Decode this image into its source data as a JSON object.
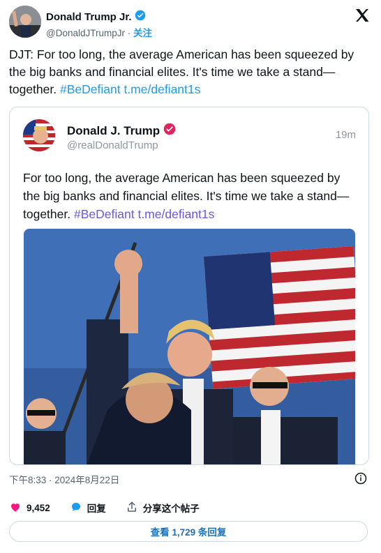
{
  "author": {
    "name": "Donald Trump Jr.",
    "handle": "@DonaldJTrumpJr",
    "separator": "·",
    "follow_label": "关注"
  },
  "tweet": {
    "text_plain": "DJT: For too long, the average American has been squeezed by the big banks and financial elites. It's time we take a stand—together. ",
    "hashtag": "#BeDefiant",
    "link": "t.me/defiant1s"
  },
  "quoted": {
    "name": "Donald J. Trump",
    "handle": "@realDonaldTrump",
    "time": "19m",
    "text_plain": "For too long, the average American has been squeezed by the big banks and financial elites. It's time we take a stand—together. ",
    "hashtag": "#BeDefiant",
    "link": "t.me/defiant1s"
  },
  "meta": {
    "timestamp": "下午8:33 · 2024年8月22日"
  },
  "actions": {
    "likes": "9,452",
    "reply_label": "回复",
    "share_label": "分享这个帖子"
  },
  "replies_button": {
    "label": "查看 1,729 条回复"
  },
  "colors": {
    "accent": "#1d9bf0",
    "like": "#f91880",
    "quoted_link": "#6e57e0",
    "verified_gold": "#1d9bf0",
    "badge_orange": "#e0245e"
  },
  "icons": [
    "x-logo-icon",
    "verified-badge-icon",
    "info-icon",
    "heart-icon",
    "reply-icon",
    "share-icon"
  ]
}
